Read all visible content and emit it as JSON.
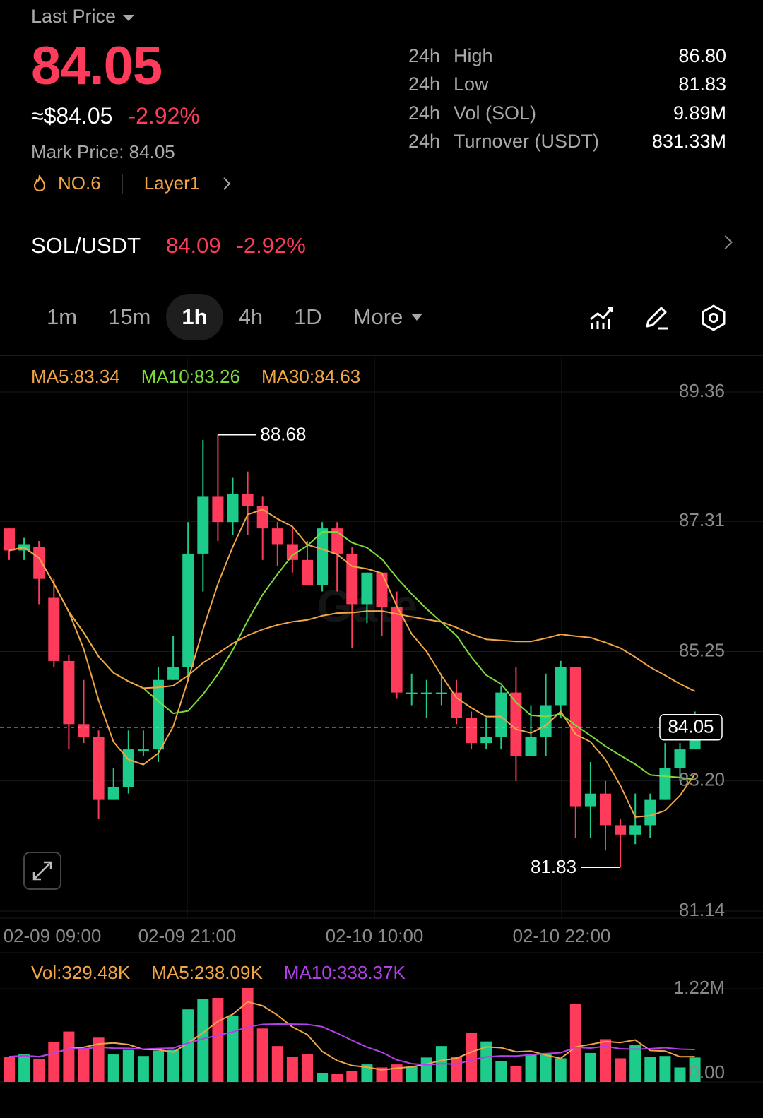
{
  "header": {
    "last_price_label": "Last Price",
    "last_price": "84.05",
    "approx": "≈$84.05",
    "change": "-2.92%",
    "mark_price": "Mark Price:  84.05",
    "rank": "NO.6",
    "category": "Layer1"
  },
  "stats": [
    {
      "period": "24h",
      "label": "High",
      "value": "86.80"
    },
    {
      "period": "24h",
      "label": "Low",
      "value": "81.83"
    },
    {
      "period": "24h",
      "label": "Vol (SOL)",
      "value": "9.89M"
    },
    {
      "period": "24h",
      "label": "Turnover (USDT)",
      "value": "831.33M"
    }
  ],
  "pair": {
    "name": "SOL/USDT",
    "price": "84.09",
    "change": "-2.92%"
  },
  "timeframes": [
    "1m",
    "15m",
    "1h",
    "4h",
    "1D"
  ],
  "active_timeframe": "1h",
  "more_label": "More",
  "toolbar_icons": [
    "indicator-icon",
    "draw-icon",
    "settings-icon"
  ],
  "ma_legend": {
    "ma5": "MA5:83.34",
    "ma10": "MA10:83.26",
    "ma30": "MA30:84.63"
  },
  "vol_legend": {
    "vol": "Vol:329.48K",
    "ma5": "MA5:238.09K",
    "ma10": "MA10:338.37K"
  },
  "colors": {
    "up": "#1dcc8a",
    "down": "#ff3b5c",
    "ma5": "#f2a544",
    "ma10": "#7ddc3a",
    "ma30": "#f2a544",
    "vol_ma10": "#b23fe8"
  },
  "chart_data": {
    "type": "candlestick",
    "price_axis_ticks": [
      "89.36",
      "87.31",
      "85.25",
      "83.20",
      "81.14"
    ],
    "price_axis_values": [
      89.36,
      87.31,
      85.25,
      83.2,
      81.14
    ],
    "x_tick_labels": [
      "02-09 09:00",
      "02-09 21:00",
      "02-10 10:00",
      "02-10 22:00"
    ],
    "current_price_label": "84.05",
    "current_price": 84.05,
    "high_label": "88.68",
    "high_value": 88.68,
    "low_label": "81.83",
    "low_value": 81.83,
    "candles": [
      [
        87.2,
        86.85,
        87.2,
        86.7
      ],
      [
        86.85,
        86.95,
        87.05,
        86.7
      ],
      [
        86.9,
        86.4,
        87.0,
        86.0
      ],
      [
        86.1,
        85.1,
        86.4,
        85.0
      ],
      [
        85.1,
        84.1,
        85.2,
        83.7
      ],
      [
        84.1,
        83.9,
        84.8,
        83.8
      ],
      [
        83.9,
        82.9,
        84.0,
        82.6
      ],
      [
        82.9,
        83.1,
        83.4,
        82.9
      ],
      [
        83.1,
        83.7,
        84.0,
        83.0
      ],
      [
        83.7,
        83.7,
        84.0,
        83.6
      ],
      [
        83.7,
        84.8,
        85.0,
        83.5
      ],
      [
        84.8,
        85.0,
        85.5,
        84.8
      ],
      [
        85.0,
        86.8,
        87.3,
        84.8
      ],
      [
        86.8,
        87.7,
        88.6,
        86.2
      ],
      [
        87.7,
        87.3,
        88.68,
        87.0
      ],
      [
        87.3,
        87.75,
        88.0,
        87.1
      ],
      [
        87.75,
        87.55,
        88.1,
        87.1
      ],
      [
        87.55,
        87.2,
        87.7,
        86.7
      ],
      [
        87.2,
        86.95,
        87.3,
        86.6
      ],
      [
        86.95,
        86.7,
        87.2,
        86.5
      ],
      [
        86.7,
        86.3,
        87.0,
        86.3
      ],
      [
        86.3,
        87.2,
        87.3,
        86.2
      ],
      [
        87.2,
        86.8,
        87.3,
        86.2
      ],
      [
        86.8,
        86.0,
        86.9,
        85.3
      ],
      [
        86.0,
        86.5,
        86.5,
        85.7
      ],
      [
        86.5,
        85.95,
        86.5,
        85.5
      ],
      [
        85.95,
        84.6,
        86.2,
        84.5
      ],
      [
        84.6,
        84.6,
        84.9,
        84.4
      ],
      [
        84.6,
        84.6,
        84.8,
        84.2
      ],
      [
        84.6,
        84.6,
        84.9,
        84.4
      ],
      [
        84.6,
        84.2,
        84.8,
        84.1
      ],
      [
        84.2,
        83.8,
        84.3,
        83.7
      ],
      [
        83.8,
        83.9,
        84.2,
        83.7
      ],
      [
        83.9,
        84.6,
        84.7,
        83.7
      ],
      [
        84.6,
        83.6,
        85.0,
        83.2
      ],
      [
        83.6,
        83.9,
        84.4,
        83.6
      ],
      [
        83.9,
        84.4,
        84.9,
        83.6
      ],
      [
        84.4,
        85.0,
        85.1,
        84.2
      ],
      [
        85.0,
        82.8,
        85.0,
        82.3
      ],
      [
        82.8,
        83.0,
        83.5,
        82.3
      ],
      [
        83.0,
        82.5,
        83.2,
        82.1
      ],
      [
        82.5,
        82.35,
        82.6,
        81.83
      ],
      [
        82.35,
        82.5,
        83.0,
        82.2
      ],
      [
        82.5,
        82.9,
        83.0,
        82.3
      ],
      [
        82.9,
        83.4,
        83.8,
        82.9
      ],
      [
        83.4,
        83.7,
        83.8,
        83.2
      ],
      [
        83.7,
        84.05,
        84.3,
        83.7
      ]
    ],
    "volume_axis_ticks": [
      "1.22M",
      "0.00"
    ],
    "volume_axis_values": [
      1220000,
      0
    ],
    "volumes": [
      330000,
      360000,
      300000,
      520000,
      660000,
      430000,
      580000,
      360000,
      420000,
      340000,
      410000,
      420000,
      950000,
      1090000,
      1100000,
      870000,
      1230000,
      700000,
      470000,
      330000,
      370000,
      120000,
      110000,
      140000,
      230000,
      190000,
      230000,
      200000,
      320000,
      470000,
      330000,
      640000,
      530000,
      270000,
      210000,
      370000,
      380000,
      310000,
      1020000,
      380000,
      560000,
      310000,
      480000,
      330000,
      340000,
      190000,
      320000
    ]
  }
}
